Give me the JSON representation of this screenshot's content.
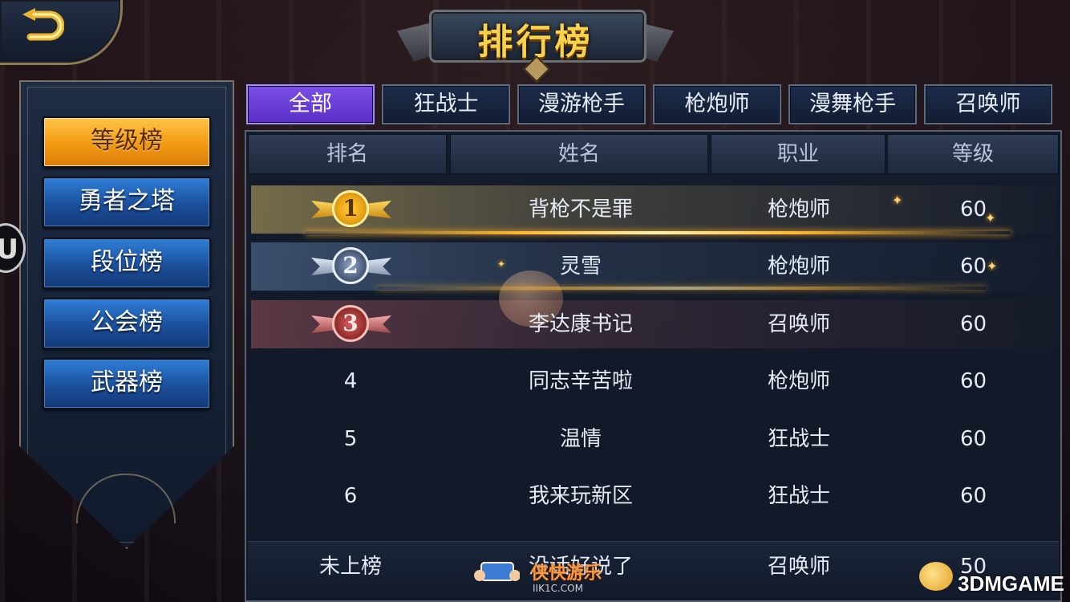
{
  "title": "排行榜",
  "sidebar": {
    "items": [
      {
        "label": "等级榜",
        "active": true
      },
      {
        "label": "勇者之塔",
        "active": false
      },
      {
        "label": "段位榜",
        "active": false
      },
      {
        "label": "公会榜",
        "active": false
      },
      {
        "label": "武器榜",
        "active": false
      }
    ]
  },
  "left_edge_icon": "U",
  "tabs": [
    {
      "label": "全部",
      "active": true
    },
    {
      "label": "狂战士",
      "active": false
    },
    {
      "label": "漫游枪手",
      "active": false
    },
    {
      "label": "枪炮师",
      "active": false
    },
    {
      "label": "漫舞枪手",
      "active": false
    },
    {
      "label": "召唤师",
      "active": false
    }
  ],
  "table": {
    "headers": [
      "排名",
      "姓名",
      "职业",
      "等级"
    ],
    "rows": [
      {
        "rank": "1",
        "name": "背枪不是罪",
        "job": "枪炮师",
        "level": "60",
        "medal": "gold"
      },
      {
        "rank": "2",
        "name": "灵雪",
        "job": "枪炮师",
        "level": "60",
        "medal": "silver"
      },
      {
        "rank": "3",
        "name": "李达康书记",
        "job": "召唤师",
        "level": "60",
        "medal": "bronze"
      },
      {
        "rank": "4",
        "name": "同志辛苦啦",
        "job": "枪炮师",
        "level": "60"
      },
      {
        "rank": "5",
        "name": "温情",
        "job": "狂战士",
        "level": "60"
      },
      {
        "rank": "6",
        "name": "我来玩新区",
        "job": "狂战士",
        "level": "60"
      }
    ],
    "self_row": {
      "rank": "未上榜",
      "name": "没话好说了",
      "job": "召唤师",
      "level": "50"
    }
  },
  "watermarks": {
    "left_text": "侠快游乐",
    "left_sub": "IIK1C.COM",
    "right_text": "3DMGAME"
  },
  "colors": {
    "active_tab": "#6a3fd8",
    "active_side": "#f29a13",
    "side_button": "#1b4f9a",
    "title_gold": "#f7d24a"
  }
}
